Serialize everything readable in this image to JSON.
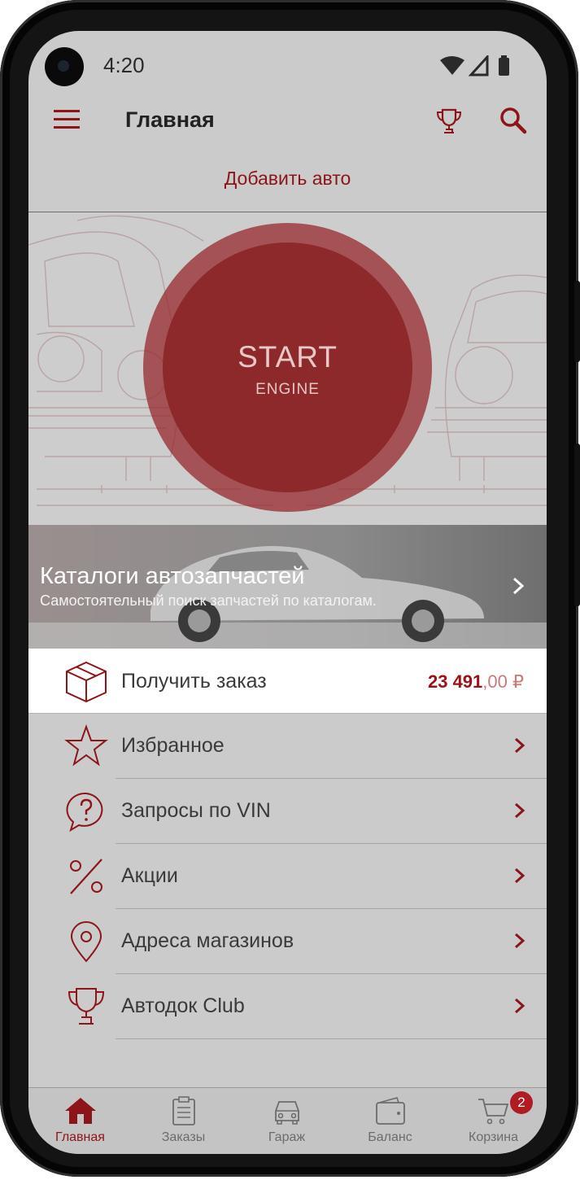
{
  "status_bar": {
    "time": "4:20"
  },
  "header": {
    "title": "Главная"
  },
  "add_car": {
    "label": "Добавить авто"
  },
  "start": {
    "main": "START",
    "sub": "ENGINE"
  },
  "catalog": {
    "title": "Каталоги автозапчастей",
    "subtitle": "Самостоятельный поиск запчастей по каталогам."
  },
  "order": {
    "label": "Получить заказ",
    "price_main": "23 491",
    "price_decimal": ",00",
    "currency": "₽"
  },
  "menu": {
    "items": [
      {
        "label": "Избранное",
        "icon": "star-icon"
      },
      {
        "label": "Запросы по VIN",
        "icon": "question-bubble-icon"
      },
      {
        "label": "Акции",
        "icon": "percent-icon"
      },
      {
        "label": "Адреса магазинов",
        "icon": "map-pin-icon"
      },
      {
        "label": "Автодок Club",
        "icon": "trophy-icon"
      }
    ]
  },
  "bottom_nav": {
    "items": [
      {
        "label": "Главная",
        "icon": "home-icon",
        "active": true
      },
      {
        "label": "Заказы",
        "icon": "clipboard-icon"
      },
      {
        "label": "Гараж",
        "icon": "car-icon"
      },
      {
        "label": "Баланс",
        "icon": "wallet-icon"
      },
      {
        "label": "Корзина",
        "icon": "cart-icon",
        "badge": "2"
      }
    ]
  },
  "colors": {
    "accent": "#8d1519",
    "background": "#cbcbcb",
    "badge": "#b01c22"
  }
}
